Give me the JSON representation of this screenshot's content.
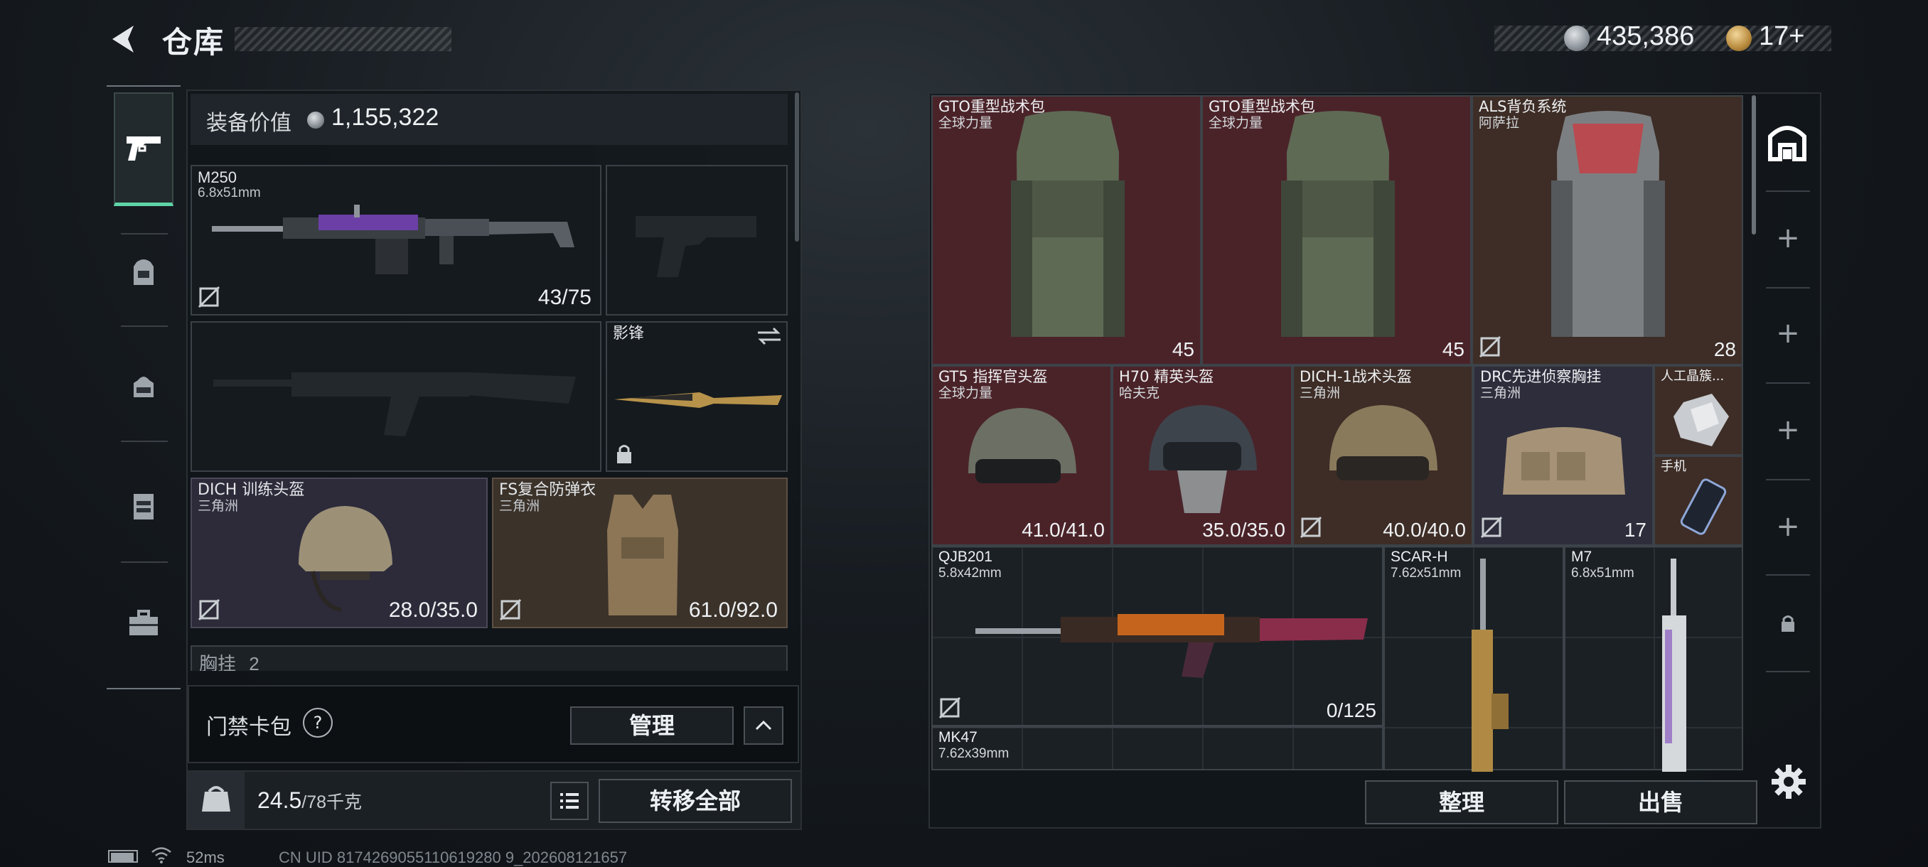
{
  "header": {
    "title": "仓库",
    "currency": {
      "money": "435,386",
      "tickets": "17+"
    }
  },
  "sidebar": {
    "items": [
      {
        "name": "weapons",
        "icon": "pistol-icon",
        "active": true
      },
      {
        "name": "backpack",
        "icon": "backpack-icon"
      },
      {
        "name": "bag",
        "icon": "bag-icon"
      },
      {
        "name": "vest",
        "icon": "vest-icon"
      },
      {
        "name": "case",
        "icon": "briefcase-icon"
      }
    ]
  },
  "equipment": {
    "value_label": "装备价值",
    "value": "1,155,322",
    "slots": {
      "primary": {
        "name": "M250",
        "caliber": "6.8x51mm",
        "value": "43/75"
      },
      "melee": {
        "name": "影锋"
      },
      "helmet": {
        "name": "DICH 训练头盔",
        "source": "三角洲",
        "value": "28.0/35.0"
      },
      "armor": {
        "name": "FS复合防弹衣",
        "source": "三角洲",
        "value": "61.0/92.0"
      },
      "chest": {
        "label": "胸挂",
        "value": "2"
      }
    },
    "keycard": {
      "label": "门禁卡包",
      "help": "?",
      "manage": "管理"
    },
    "weight": {
      "current": "24.5",
      "max": "/78千克"
    },
    "transfer_all": "转移全部"
  },
  "status": {
    "ping": "52ms",
    "uid": "CN UID 8174269055110619280 9_202608121657"
  },
  "stash": {
    "items": [
      {
        "key": "gto1",
        "name": "GTO重型战术包",
        "source": "全球力量",
        "value": "45",
        "color": "#4a2329"
      },
      {
        "key": "gto2",
        "name": "GTO重型战术包",
        "source": "全球力量",
        "value": "45",
        "color": "#4a2329"
      },
      {
        "key": "als",
        "name": "ALS背负系统",
        "source": "阿萨拉",
        "value": "28",
        "color": "#3d2d26"
      },
      {
        "key": "gt5",
        "name": "GT5 指挥官头盔",
        "source": "全球力量",
        "value": "41.0/41.0",
        "color": "#4a2329"
      },
      {
        "key": "h70",
        "name": "H70 精英头盔",
        "source": "哈夫克",
        "value": "35.0/35.0",
        "color": "#4a2329"
      },
      {
        "key": "dich1",
        "name": "DICH-1战术头盔",
        "source": "三角洲",
        "value": "40.0/40.0",
        "color": "#3d2d26"
      },
      {
        "key": "drc",
        "name": "DRC先进侦察胸挂",
        "source": "三角洲",
        "value": "17",
        "color": "#2e2d3c"
      },
      {
        "key": "crystal",
        "name": "人工晶簇..."
      },
      {
        "key": "phone",
        "name": "手机"
      },
      {
        "key": "qjb",
        "name": "QJB201",
        "caliber": "5.8x42mm",
        "value": "0/125"
      },
      {
        "key": "scarh",
        "name": "SCAR-H",
        "caliber": "7.62x51mm"
      },
      {
        "key": "m7",
        "name": "M7",
        "caliber": "6.8x51mm"
      },
      {
        "key": "mk47",
        "name": "MK47",
        "caliber": "7.62x39mm"
      }
    ],
    "sort": "整理",
    "sell": "出售"
  }
}
